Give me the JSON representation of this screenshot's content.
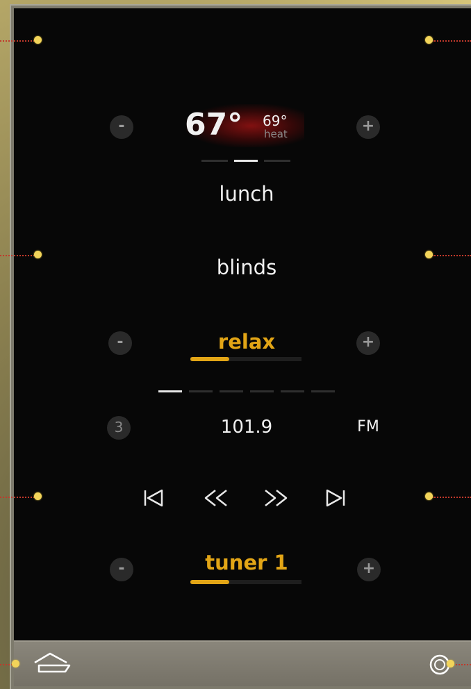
{
  "climate": {
    "current_temp": "67°",
    "setpoint": "69°",
    "mode": "heat",
    "decrease_label": "-",
    "increase_label": "+"
  },
  "scenes": {
    "item_1": "lunch",
    "item_2": "blinds"
  },
  "lighting": {
    "scene_label": "relax",
    "decrease_label": "-",
    "increase_label": "+",
    "level_fraction": 0.35
  },
  "radio": {
    "preset_number": "3",
    "frequency": "101.9",
    "band": "FM",
    "preset_count": 6,
    "active_preset_index": 0
  },
  "source": {
    "label": "tuner 1",
    "decrease_label": "-",
    "increase_label": "+",
    "volume_fraction": 0.35
  },
  "colors": {
    "accent": "#e2a516",
    "text": "#f1f1f1",
    "background": "#070707",
    "callout_dot": "#f2d45a"
  },
  "icons": {
    "home": "home-icon",
    "power": "power-icon",
    "skip_back": "skip-back-icon",
    "rewind": "rewind-icon",
    "fast_forward": "fast-forward-icon",
    "skip_forward": "skip-forward-icon"
  }
}
